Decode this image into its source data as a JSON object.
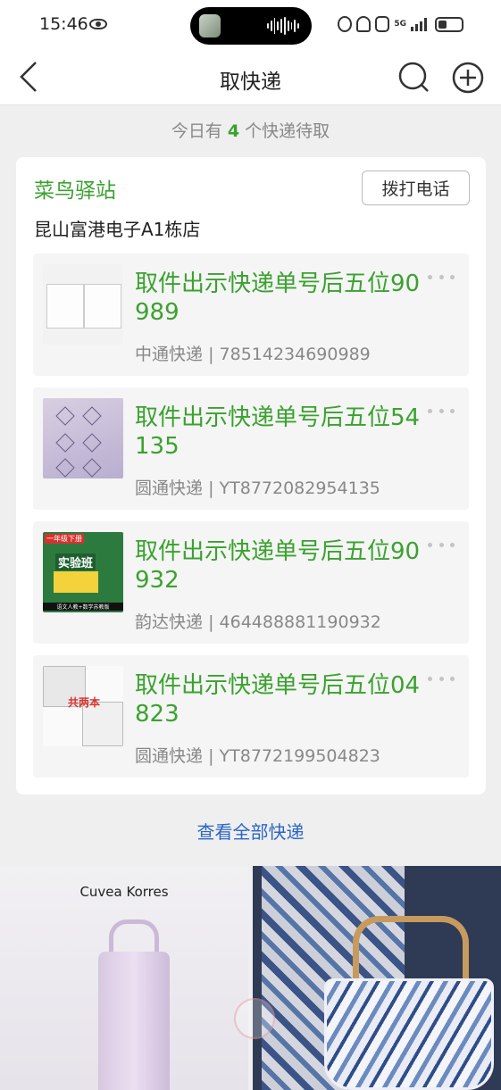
{
  "status_bar": {
    "time": "15:46",
    "network": "5G"
  },
  "nav": {
    "title": "取快递"
  },
  "summary": {
    "prefix": "今日有",
    "count": "4",
    "suffix": "个快递待取"
  },
  "station": {
    "name": "菜鸟驿站",
    "call_label": "拨打电话",
    "address": "昆山富港电子A1栋店"
  },
  "packages": [
    {
      "title": "取件出示快递单号后五位90989",
      "carrier": "中通快递",
      "tracking": "78514234690989"
    },
    {
      "title": "取件出示快递单号后五位54135",
      "carrier": "圆通快递",
      "tracking": "YT8772082954135"
    },
    {
      "title": "取件出示快递单号后五位90932",
      "carrier": "韵达快递",
      "tracking": "464488881190932"
    },
    {
      "title": "取件出示快递单号后五位04823",
      "carrier": "圆通快递",
      "tracking": "YT8772199504823"
    }
  ],
  "package_meta_separator": "|",
  "thumb_texts": {
    "thumb3_top": "一年级下册",
    "thumb3_main": "实验班",
    "thumb3_bottom": "语文人教+数学苏教版",
    "thumb4": "共两本"
  },
  "view_all_label": "查看全部快递",
  "promo": {
    "left_brand": "Cuvea Korres"
  },
  "colors": {
    "accent_green": "#3aa22e",
    "link_blue": "#2a66c5"
  }
}
